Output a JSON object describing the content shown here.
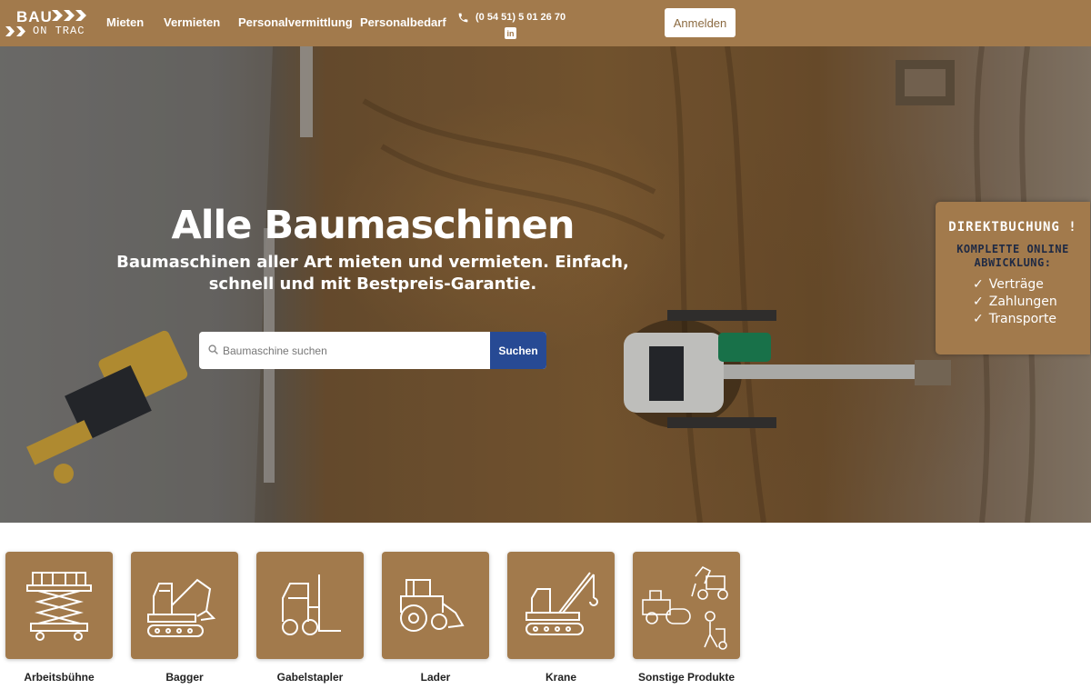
{
  "header": {
    "logo": {
      "line1": "BAU",
      "line2": "ON TRAC"
    },
    "nav": [
      {
        "label": "Mieten"
      },
      {
        "label": "Vermieten"
      },
      {
        "label": "Personalvermittlung"
      },
      {
        "label": "Personalbedarf"
      }
    ],
    "phone": "(0 54 51) 5 01 26 70",
    "linkedin_icon": "linkedin-icon",
    "login_label": "Anmelden",
    "background_color": "#a27a4c"
  },
  "hero": {
    "title": "Alle Baumaschinen",
    "subtitle": "Baumaschinen aller Art mieten und vermieten. Einfach, schnell und mit Bestpreis-Garantie.",
    "search": {
      "placeholder": "Baumaschine suchen",
      "value": "",
      "button_label": "Suchen",
      "button_color": "#274a94"
    }
  },
  "promo": {
    "heading": "DIREKTBUCHUNG !",
    "subheading": "KOMPLETTE ONLINE ABWICKLUNG:",
    "items": [
      "Verträge",
      "Zahlungen",
      "Transporte"
    ]
  },
  "categories": [
    {
      "label": "Arbeitsbühne",
      "icon": "scissor-lift-icon"
    },
    {
      "label": "Bagger",
      "icon": "excavator-icon"
    },
    {
      "label": "Gabelstapler",
      "icon": "forklift-icon"
    },
    {
      "label": "Lader",
      "icon": "loader-icon"
    },
    {
      "label": "Krane",
      "icon": "crane-icon"
    },
    {
      "label": "Sonstige Produkte",
      "icon": "misc-machines-icon"
    }
  ]
}
